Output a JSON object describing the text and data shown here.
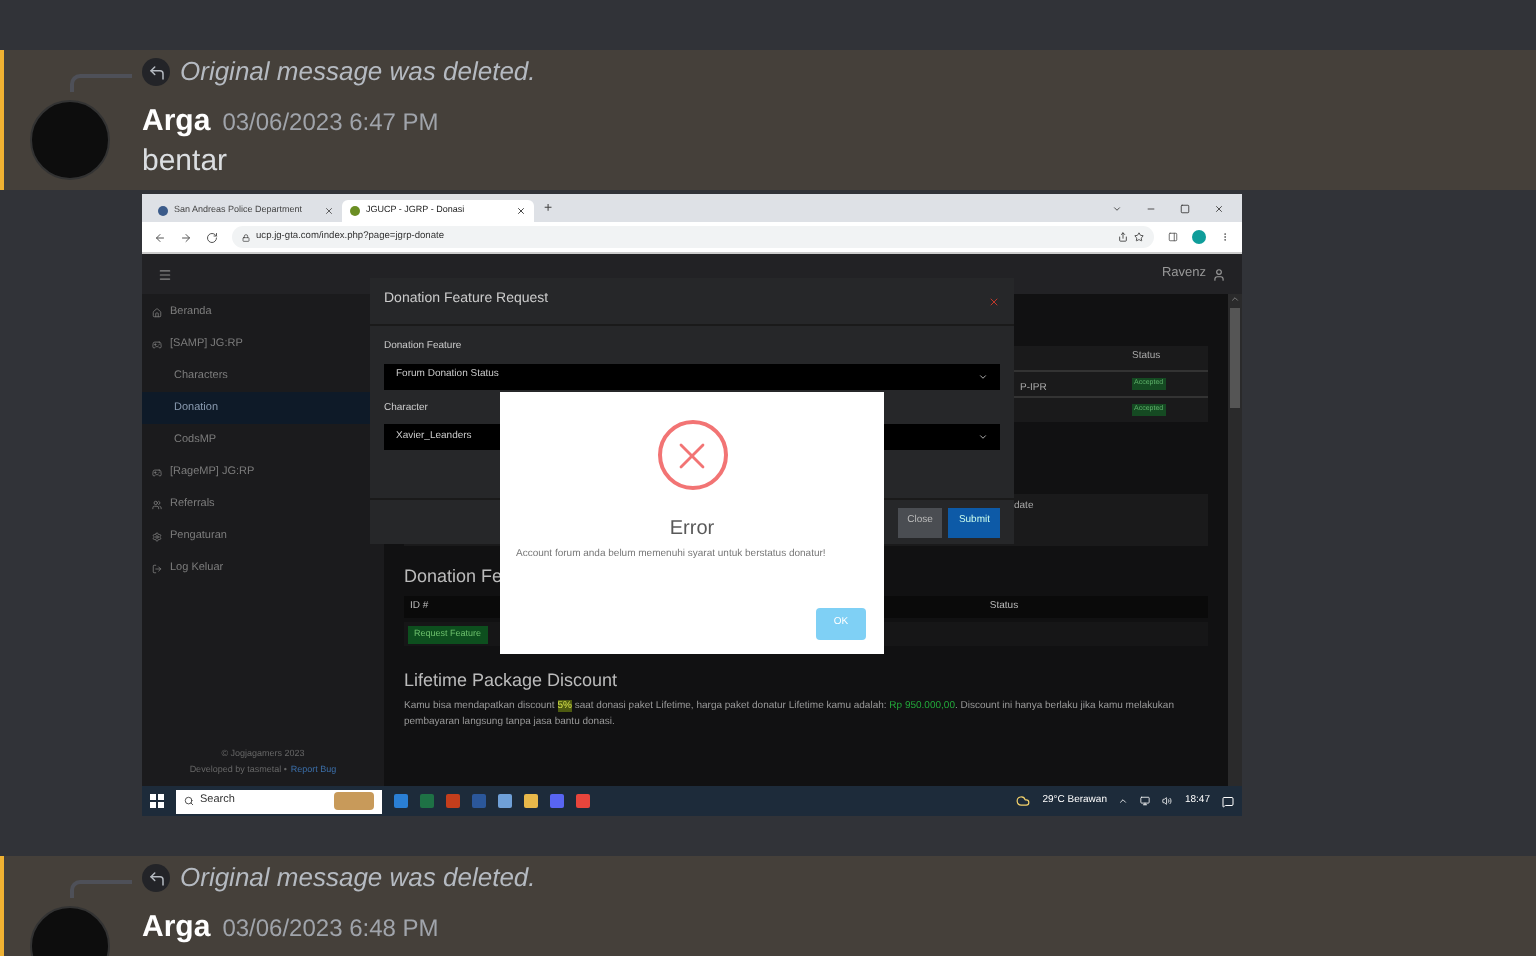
{
  "messages": [
    {
      "highlighted": true,
      "reply": "Original message was deleted.",
      "author": "Arga",
      "timestamp": "03/06/2023 6:47 PM",
      "content": "bentar",
      "attachment": {
        "browser": {
          "tabs": [
            {
              "title": "San Andreas Police Department",
              "selected": false
            },
            {
              "title": "JGUCP - JGRP - Donasi",
              "selected": true
            }
          ],
          "new_tab": "+",
          "url": "ucp.jg-gta.com/index.php?page=jgrp-donate"
        },
        "header": {
          "username": "Ravenz"
        },
        "sidebar": {
          "items": [
            {
              "label": "Beranda",
              "kind": "home",
              "selected": false
            },
            {
              "label": "[SAMP] JG:RP",
              "kind": "game",
              "selected": false
            },
            {
              "label": "Characters",
              "kind": "sub",
              "selected": false
            },
            {
              "label": "Donation",
              "kind": "sub",
              "selected": true
            },
            {
              "label": "CodsMP",
              "kind": "sub",
              "selected": false
            },
            {
              "label": "[RageMP] JG:RP",
              "kind": "game",
              "selected": false
            },
            {
              "label": "Referrals",
              "kind": "users",
              "selected": false
            },
            {
              "label": "Pengaturan",
              "kind": "settings",
              "selected": false
            },
            {
              "label": "Log Keluar",
              "kind": "logout",
              "selected": false
            }
          ],
          "copyright": "© Jogjagamers 2023",
          "credit": "Developed by tasmetal •",
          "report_link": "Report Bug"
        },
        "content": {
          "top_table": {
            "cell": "P-IPR",
            "status_header": "Status",
            "badges": [
              "Accepted",
              "Accepted"
            ]
          },
          "second_table_header": "date",
          "section_title": "Donation Fe",
          "table_headers": [
            "ID #",
            "Status"
          ],
          "request_button": "Request Feature",
          "discount_title": "Lifetime Package Discount",
          "discount_text": [
            {
              "text": "Kamu bisa mendapatkan discount ",
              "kind": "plain"
            },
            {
              "text": "5%",
              "kind": "highlight"
            },
            {
              "text": " saat donasi paket Lifetime, harga paket donatur Lifetime kamu adalah: ",
              "kind": "plain"
            },
            {
              "text": "Rp 950.000,00",
              "kind": "price"
            },
            {
              "text": ". Discount ini hanya berlaku jika kamu melakukan pembayaran langsung tanpa jasa bantu donasi.",
              "kind": "plain"
            }
          ]
        },
        "modal": {
          "title": "Donation Feature Request",
          "fields": [
            {
              "label": "Donation Feature",
              "value": "Forum Donation Status"
            },
            {
              "label": "Character",
              "value": "Xavier_Leanders"
            }
          ],
          "buttons": [
            {
              "label": "Close",
              "kind": "secondary"
            },
            {
              "label": "Submit",
              "kind": "primary"
            }
          ]
        },
        "error_dialog": {
          "title": "Error",
          "message": "Account forum anda belum memenuhi syarat untuk berstatus donatur!",
          "button": "OK"
        },
        "taskbar": {
          "search": "Search",
          "weather": "29°C Berawan",
          "time": "18:47"
        }
      }
    },
    {
      "highlighted": true,
      "reply": "Original message was deleted.",
      "author": "Arga",
      "timestamp": "03/06/2023 6:48 PM"
    }
  ]
}
